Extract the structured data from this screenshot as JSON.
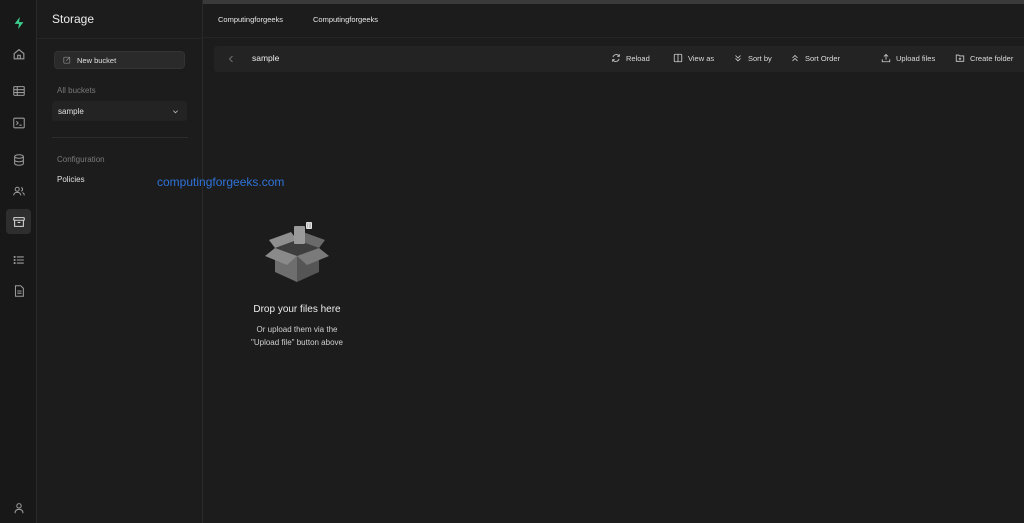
{
  "colors": {
    "brand": "#3ecf8e",
    "background": "#1c1c1c",
    "rail": "#181818",
    "watermark": "#2f73d8"
  },
  "rail": {
    "items": [
      {
        "icon": "logo-icon"
      },
      {
        "icon": "home-icon"
      },
      {
        "icon": "table-icon"
      },
      {
        "icon": "terminal-icon"
      },
      {
        "icon": "database-icon"
      },
      {
        "icon": "users-icon"
      },
      {
        "icon": "storage-icon",
        "active": true
      },
      {
        "icon": "list-icon"
      },
      {
        "icon": "document-icon"
      },
      {
        "icon": "user-icon"
      }
    ]
  },
  "storage": {
    "title": "Storage",
    "new_bucket_label": "New bucket",
    "all_buckets_label": "All buckets",
    "buckets": [
      {
        "name": "sample"
      }
    ],
    "configuration_label": "Configuration",
    "policies_label": "Policies"
  },
  "watermark": "computingforgeeks.com",
  "header": {
    "breadcrumbs": [
      "Computingforgeeks",
      "Computingforgeeks"
    ]
  },
  "toolbar": {
    "folder": "sample",
    "reload": "Reload",
    "view_as": "View as",
    "sort_by": "Sort by",
    "sort_order": "Sort Order",
    "upload_files": "Upload files",
    "create_folder": "Create folder"
  },
  "empty_state": {
    "title": "Drop your files here",
    "subtitle": "Or upload them via the \"Upload file\" button above"
  }
}
